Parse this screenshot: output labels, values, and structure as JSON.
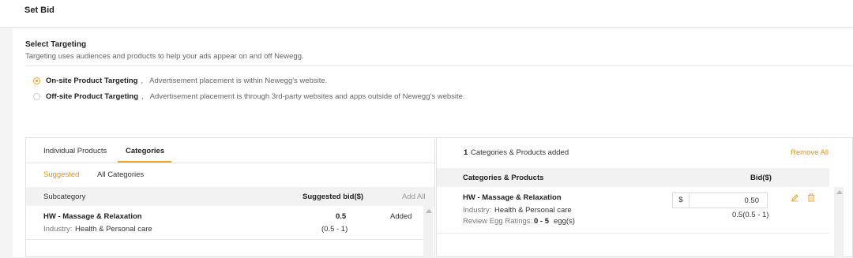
{
  "header": {
    "title": "Set Bid"
  },
  "targeting": {
    "title": "Select Targeting",
    "description": "Targeting uses audiences and products to help your ads appear on and off Newegg.",
    "options": [
      {
        "label": "On-site Product Targeting",
        "sep": ",",
        "desc": "Advertisement placement is within Newegg's website.",
        "selected": true
      },
      {
        "label": "Off-site Product Targeting",
        "sep": ",",
        "desc": "Advertisement placement is through 3rd-party websites and apps outside of Newegg's website.",
        "selected": false
      }
    ]
  },
  "left_panel": {
    "tabs": [
      "Individual Products",
      "Categories"
    ],
    "active_tab": "Categories",
    "subtabs": [
      "Suggested",
      "All Categories"
    ],
    "active_subtab": "Suggested",
    "columns": {
      "subcategory": "Subcategory",
      "suggested_bid": "Suggested bid($)",
      "add_all": "Add All"
    },
    "rows": [
      {
        "name": "HW - Massage & Relaxation",
        "industry_label": "Industry:",
        "industry": "Health & Personal care",
        "bid": "0.5",
        "range": "(0.5 - 1)",
        "status": "Added"
      }
    ]
  },
  "right_panel": {
    "summary_count": "1",
    "summary_text": "Categories & Products added",
    "remove_all": "Remove All",
    "columns": {
      "name": "Categories & Products",
      "bid": "Bid($)"
    },
    "rows": [
      {
        "name": "HW - Massage & Relaxation",
        "industry_label": "Industry:",
        "industry": "Health & Personal care",
        "rating_label": "Review Egg Ratings:",
        "rating": "0 - 5",
        "rating_unit": "egg(s)",
        "currency": "$",
        "bid": "0.50",
        "range": "0.5(0.5 - 1)"
      }
    ]
  },
  "colors": {
    "accent": "#f0a020",
    "accent_text": "#e3931b"
  },
  "icons": [
    "edit-icon",
    "delete-icon",
    "scroll-up-arrow-icon"
  ]
}
